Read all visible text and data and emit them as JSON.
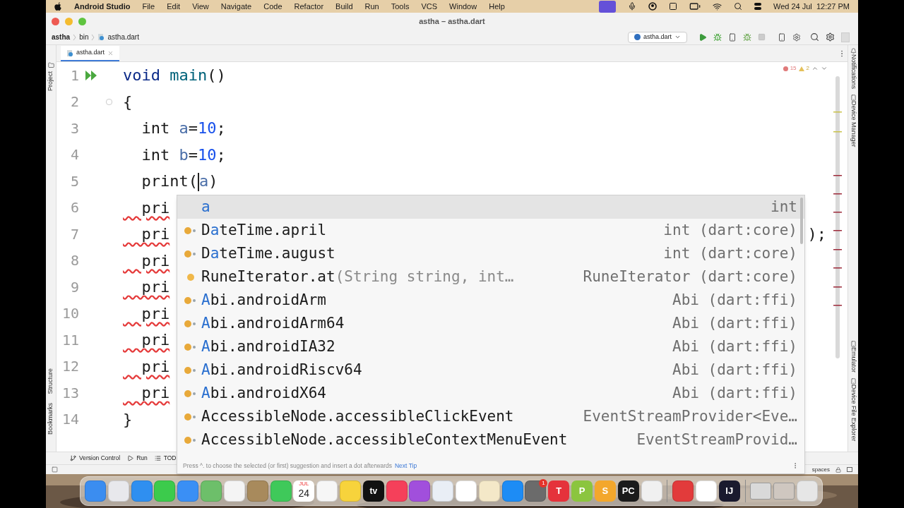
{
  "menubar": {
    "app_name": "Android Studio",
    "menus": [
      "File",
      "Edit",
      "View",
      "Navigate",
      "Code",
      "Refactor",
      "Build",
      "Run",
      "Tools",
      "VCS",
      "Window",
      "Help"
    ],
    "clock": "Wed 24 Jul  12:27 PM"
  },
  "window": {
    "title": "astha – astha.dart"
  },
  "breadcrumbs": [
    "astha",
    "bin",
    "astha.dart"
  ],
  "run_config": "astha.dart",
  "tabs": [
    {
      "label": "astha.dart",
      "selected": true
    }
  ],
  "inspections": {
    "errors": "15",
    "warnings": "2"
  },
  "left_tools": [
    "Project",
    "Structure",
    "Bookmarks"
  ],
  "right_tools_top": [
    "Notifications",
    "Device Manager"
  ],
  "right_tools_bottom": [
    "Emulator",
    "Device File Explorer"
  ],
  "code_lines": [
    {
      "number": "1",
      "error": false,
      "tokens": [
        {
          "kind": "keyword",
          "text": "void"
        },
        {
          "kind": "function",
          "text": " main"
        },
        {
          "kind": "plain",
          "text": "()"
        }
      ]
    },
    {
      "number": "2",
      "error": false,
      "tokens": [
        {
          "kind": "plain",
          "text": "{"
        }
      ]
    },
    {
      "number": "3",
      "error": false,
      "tokens": [
        {
          "kind": "plain",
          "text": "  int "
        },
        {
          "kind": "var",
          "text": "a"
        },
        {
          "kind": "plain",
          "text": "="
        },
        {
          "kind": "number",
          "text": "10"
        },
        {
          "kind": "plain",
          "text": ";"
        }
      ]
    },
    {
      "number": "4",
      "error": false,
      "tokens": [
        {
          "kind": "plain",
          "text": "  int "
        },
        {
          "kind": "var",
          "text": "b"
        },
        {
          "kind": "plain",
          "text": "="
        },
        {
          "kind": "number",
          "text": "10"
        },
        {
          "kind": "plain",
          "text": ";"
        }
      ]
    },
    {
      "number": "5",
      "error": false,
      "tokens": [
        {
          "kind": "plain",
          "text": "  print("
        },
        {
          "kind": "caret"
        },
        {
          "kind": "var",
          "text": "a"
        },
        {
          "kind": "plain",
          "text": ")"
        }
      ]
    },
    {
      "number": "6",
      "error": true,
      "tokens": [
        {
          "kind": "plain",
          "text": "  pri"
        }
      ]
    },
    {
      "number": "7",
      "error": true,
      "tokens": [
        {
          "kind": "plain",
          "text": "  pri"
        }
      ],
      "tail": ");"
    },
    {
      "number": "8",
      "error": true,
      "tokens": [
        {
          "kind": "plain",
          "text": "  pri"
        }
      ]
    },
    {
      "number": "9",
      "error": true,
      "tokens": [
        {
          "kind": "plain",
          "text": "  pri"
        }
      ]
    },
    {
      "number": "10",
      "error": true,
      "tokens": [
        {
          "kind": "plain",
          "text": "  pri"
        }
      ]
    },
    {
      "number": "11",
      "error": true,
      "tokens": [
        {
          "kind": "plain",
          "text": "  pri"
        }
      ]
    },
    {
      "number": "12",
      "error": true,
      "tokens": [
        {
          "kind": "plain",
          "text": "  pri"
        }
      ]
    },
    {
      "number": "13",
      "error": true,
      "tokens": [
        {
          "kind": "plain",
          "text": "  pri"
        }
      ]
    },
    {
      "number": "14",
      "error": false,
      "tokens": [
        {
          "kind": "plain",
          "text": "}"
        }
      ]
    }
  ],
  "completion": {
    "items": [
      {
        "kind": "variable",
        "selected": true,
        "match": "a",
        "type": "int"
      },
      {
        "kind": "field",
        "selected": false,
        "before": "D",
        "match": "a",
        "after": "teTime.april",
        "type": "int (dart:core)"
      },
      {
        "kind": "field",
        "selected": false,
        "before": "D",
        "match": "a",
        "after": "teTime.august",
        "type": "int (dart:core)"
      },
      {
        "kind": "method",
        "selected": false,
        "before": "RuneIterator.at",
        "params": "(String string, int…",
        "type": "RuneIterator (dart:core)"
      },
      {
        "kind": "field",
        "selected": false,
        "match": "A",
        "after": "bi.androidArm",
        "type": "Abi (dart:ffi)"
      },
      {
        "kind": "field",
        "selected": false,
        "match": "A",
        "after": "bi.androidArm64",
        "type": "Abi (dart:ffi)"
      },
      {
        "kind": "field",
        "selected": false,
        "match": "A",
        "after": "bi.androidIA32",
        "type": "Abi (dart:ffi)"
      },
      {
        "kind": "field",
        "selected": false,
        "match": "A",
        "after": "bi.androidRiscv64",
        "type": "Abi (dart:ffi)"
      },
      {
        "kind": "field",
        "selected": false,
        "match": "A",
        "after": "bi.androidX64",
        "type": "Abi (dart:ffi)"
      },
      {
        "kind": "field",
        "selected": false,
        "before": "AccessibleNode.accessibleClickEvent",
        "type": "EventStreamProvider<Eve…"
      },
      {
        "kind": "field",
        "selected": false,
        "before": "AccessibleNode.accessibleContextMenuEvent",
        "type": "EventStreamProvid…"
      }
    ],
    "hint": "Press ^. to choose the selected (or first) suggestion and insert a dot afterwards",
    "hint_link": "Next Tip"
  },
  "bottom_tools": [
    {
      "kind": "vcs",
      "label": "Version Control"
    },
    {
      "kind": "run",
      "label": "Run"
    },
    {
      "kind": "todo",
      "label": "TOD"
    }
  ],
  "status": {
    "indent": "spaces"
  },
  "dock": [
    {
      "kind": "app",
      "color": "#3b8df0"
    },
    {
      "kind": "app",
      "color": "#e8e8ec"
    },
    {
      "kind": "app",
      "color": "#2f8ff0"
    },
    {
      "kind": "app",
      "color": "#3ccb4c"
    },
    {
      "kind": "app",
      "color": "#3a8ff5"
    },
    {
      "kind": "app",
      "color": "#6dbf6a"
    },
    {
      "kind": "app",
      "color": "#f4f4f4"
    },
    {
      "kind": "app",
      "color": "#a88a5c"
    },
    {
      "kind": "app",
      "color": "#3fc95a"
    },
    {
      "kind": "calendar",
      "color": "#ffffff",
      "month": "JUL",
      "day": "24"
    },
    {
      "kind": "app",
      "color": "#f6f6f6"
    },
    {
      "kind": "app",
      "color": "#f7d33c"
    },
    {
      "kind": "tv",
      "color": "#111111",
      "label": "tv"
    },
    {
      "kind": "app",
      "color": "#f5405a"
    },
    {
      "kind": "app",
      "color": "#a14fdc"
    },
    {
      "kind": "app",
      "color": "#e9eef5"
    },
    {
      "kind": "app",
      "color": "#ffffff"
    },
    {
      "kind": "app",
      "color": "#f4e8c8"
    },
    {
      "kind": "app",
      "color": "#1d8cf5"
    },
    {
      "kind": "app",
      "color": "#6b6b6b",
      "badge": "1"
    },
    {
      "kind": "letter",
      "color": "#e5323b",
      "label": "T"
    },
    {
      "kind": "letter",
      "color": "#8bc53f",
      "label": "P"
    },
    {
      "kind": "letter",
      "color": "#f3a72c",
      "label": "S"
    },
    {
      "kind": "letter",
      "color": "#1b1b1b",
      "label": "PC"
    },
    {
      "kind": "app",
      "color": "#f0f0f0"
    },
    {
      "kind": "separator",
      "color": "#8a8a8a"
    },
    {
      "kind": "app",
      "color": "#e23b3b"
    },
    {
      "kind": "app",
      "color": "#ffffff"
    },
    {
      "kind": "letter",
      "color": "#1a1a2e",
      "label": "IJ"
    },
    {
      "kind": "separator",
      "color": "#8a8a8a"
    },
    {
      "kind": "window",
      "color": "#d9d9d9"
    },
    {
      "kind": "window",
      "color": "#cfc7c0"
    },
    {
      "kind": "app",
      "color": "#e6e6e6"
    }
  ]
}
